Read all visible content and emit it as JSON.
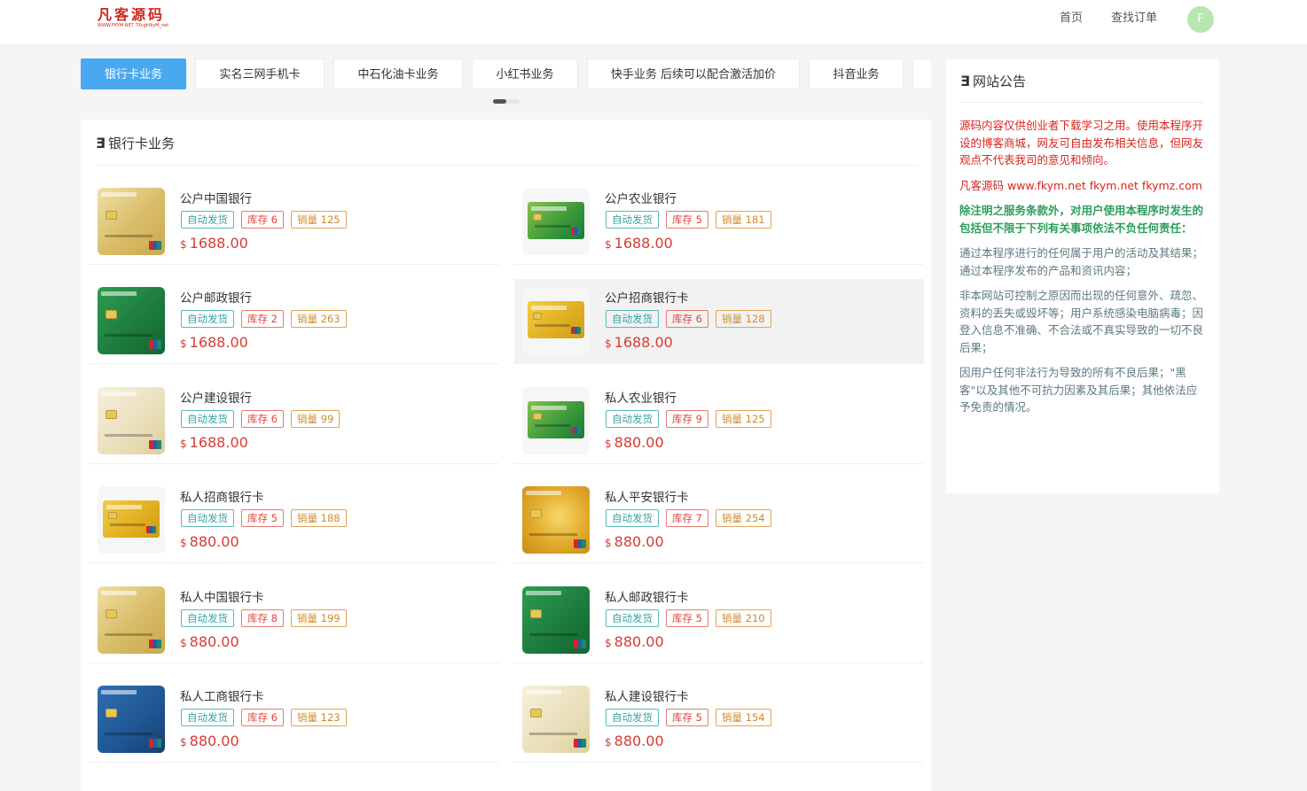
{
  "header": {
    "logo_text": "凡客源码",
    "logo_sub": "WWW.FKYM.NET  7XcgkfkyM_net",
    "nav": [
      {
        "label": "首页"
      },
      {
        "label": "查找订单"
      }
    ],
    "avatar_letter": "F"
  },
  "tabs": [
    {
      "label": "银行卡业务",
      "active": true
    },
    {
      "label": "实名三网手机卡"
    },
    {
      "label": "中石化油卡业务"
    },
    {
      "label": "小红书业务"
    },
    {
      "label": "快手业务 后续可以配合激活加价"
    },
    {
      "label": "抖音业务"
    }
  ],
  "section": {
    "icon": "Ǝ",
    "title": "银行卡业务"
  },
  "products": [
    {
      "name": "公户中国银行",
      "auto": "自动发货",
      "stock": "库存 6",
      "sales": "销量 125",
      "currency": "$",
      "price": "1688.00",
      "style": "gold"
    },
    {
      "name": "公户农业银行",
      "auto": "自动发货",
      "stock": "库存 5",
      "sales": "销量 181",
      "currency": "$",
      "price": "1688.00",
      "style": "abc"
    },
    {
      "name": "公户邮政银行",
      "auto": "自动发货",
      "stock": "库存 2",
      "sales": "销量 263",
      "currency": "$",
      "price": "1688.00",
      "style": "green"
    },
    {
      "name": "公户招商银行卡",
      "auto": "自动发货",
      "stock": "库存 6",
      "sales": "销量 128",
      "currency": "$",
      "price": "1688.00",
      "style": "cmb"
    },
    {
      "name": "公户建设银行",
      "auto": "自动发货",
      "stock": "库存 6",
      "sales": "销量 99",
      "currency": "$",
      "price": "1688.00",
      "style": "ccb"
    },
    {
      "name": "私人农业银行",
      "auto": "自动发货",
      "stock": "库存 9",
      "sales": "销量 125",
      "currency": "$",
      "price": "880.00",
      "style": "abc"
    },
    {
      "name": "私人招商银行卡",
      "auto": "自动发货",
      "stock": "库存 5",
      "sales": "销量 188",
      "currency": "$",
      "price": "880.00",
      "style": "cmb"
    },
    {
      "name": "私人平安银行卡",
      "auto": "自动发货",
      "stock": "库存 7",
      "sales": "销量 254",
      "currency": "$",
      "price": "880.00",
      "style": "pab"
    },
    {
      "name": "私人中国银行卡",
      "auto": "自动发货",
      "stock": "库存 8",
      "sales": "销量 199",
      "currency": "$",
      "price": "880.00",
      "style": "gold"
    },
    {
      "name": "私人邮政银行卡",
      "auto": "自动发货",
      "stock": "库存 5",
      "sales": "销量 210",
      "currency": "$",
      "price": "880.00",
      "style": "green"
    },
    {
      "name": "私人工商银行卡",
      "auto": "自动发货",
      "stock": "库存 6",
      "sales": "销量 123",
      "currency": "$",
      "price": "880.00",
      "style": "icbc"
    },
    {
      "name": "私人建设银行卡",
      "auto": "自动发货",
      "stock": "库存 5",
      "sales": "销量 154",
      "currency": "$",
      "price": "880.00",
      "style": "ccb"
    }
  ],
  "notice": {
    "icon": "Ǝ",
    "title": "网站公告",
    "p1": "源码内容仅供创业者下载学习之用。使用本程序开设的博客商城，网友可自由发布相关信息，但网友观点不代表我司的意见和倾向。",
    "p2": "凡客源码 www.fkym.net fkym.net fkymz.com",
    "p3": "除注明之服务条款外，对用户使用本程序时发生的包括但不限于下列有关事项依法不负任何责任：",
    "p4": "通过本程序进行的任何属于用户的活动及其结果；通过本程序发布的产品和资讯内容；",
    "p5": "非本网站可控制之原因而出现的任何意外、疏忽、资料的丢失或毁坏等；用户系统感染电脑病毒；因登入信息不准确、不合法或不真实导致的一切不良后果；",
    "p6": "因用户任何非法行为导致的所有不良后果；\"黑客\"以及其他不可抗力因素及其后果；其他依法应予免责的情况。"
  },
  "colors": {
    "accent": "#4aa8f0",
    "price": "#d63c33",
    "brand": "#d0261d"
  }
}
